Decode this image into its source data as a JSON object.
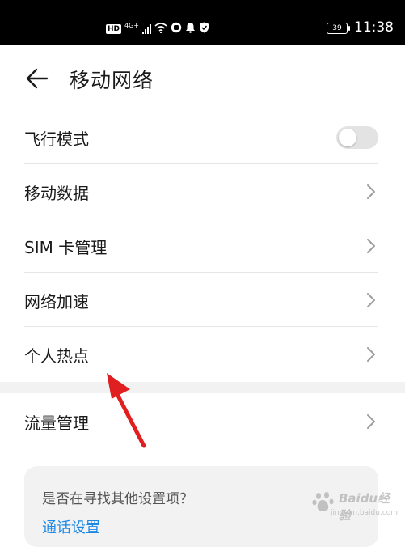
{
  "status_bar": {
    "hd": "HD",
    "network": "4G+",
    "battery": "39",
    "time": "11:38"
  },
  "header": {
    "title": "移动网络"
  },
  "settings": {
    "items": [
      {
        "label": "飞行模式",
        "control": "toggle",
        "toggle_on": false
      },
      {
        "label": "移动数据",
        "control": "chevron"
      },
      {
        "label": "SIM 卡管理",
        "control": "chevron"
      },
      {
        "label": "网络加速",
        "control": "chevron"
      },
      {
        "label": "个人热点",
        "control": "chevron"
      }
    ],
    "traffic": {
      "label": "流量管理",
      "control": "chevron"
    }
  },
  "suggestion_card": {
    "question": "是否在寻找其他设置项？",
    "link": "通话设置"
  },
  "watermark": {
    "line1": "Baidu经验",
    "line2": "jingyan.baidu.com"
  },
  "colors": {
    "accent_link": "#1e88e5",
    "annotation_arrow": "#e02020",
    "toggle_off": "#e3e3e3"
  }
}
